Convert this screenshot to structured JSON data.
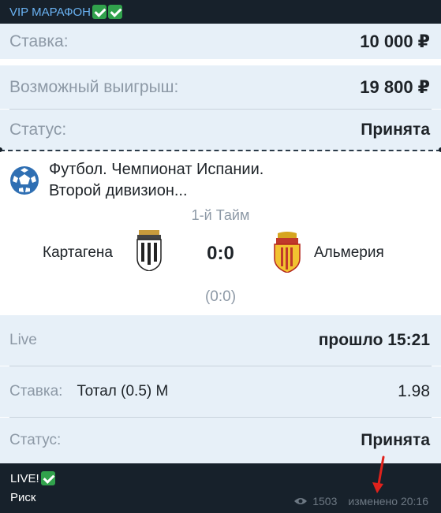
{
  "channel": {
    "title": "VIP МАРАФОН"
  },
  "bet_summary": {
    "stake_label": "Ставка:",
    "stake_value": "10 000 ₽",
    "win_label": "Возможный выигрыш:",
    "win_value": "19 800 ₽",
    "status_label": "Статус:",
    "status_value": "Принята"
  },
  "match": {
    "title_line1": "Футбол. Чемпионат Испании.",
    "title_line2": "Второй дивизион...",
    "period": "1-й Тайм",
    "home_team": "Картагена",
    "away_team": "Альмерия",
    "score": "0:0",
    "halftime_score": "(0:0)",
    "sport_icon": "soccer-ball-icon"
  },
  "live_info": {
    "label": "Live",
    "elapsed": "прошло 15:21"
  },
  "bet_detail": {
    "stake_label": "Ставка:",
    "market": "Тотал (0.5) М",
    "odds": "1.98",
    "status_label": "Статус:",
    "status_value": "Принята"
  },
  "post_footer": {
    "caption_line1": "LIVE!",
    "caption_line2": "Риск",
    "views": "1503",
    "edited": "изменено 20:16"
  },
  "colors": {
    "accent": "#6ab2f2",
    "check": "#31a24c",
    "row_bg": "#e7f0f8",
    "arrow": "#e0221c"
  }
}
